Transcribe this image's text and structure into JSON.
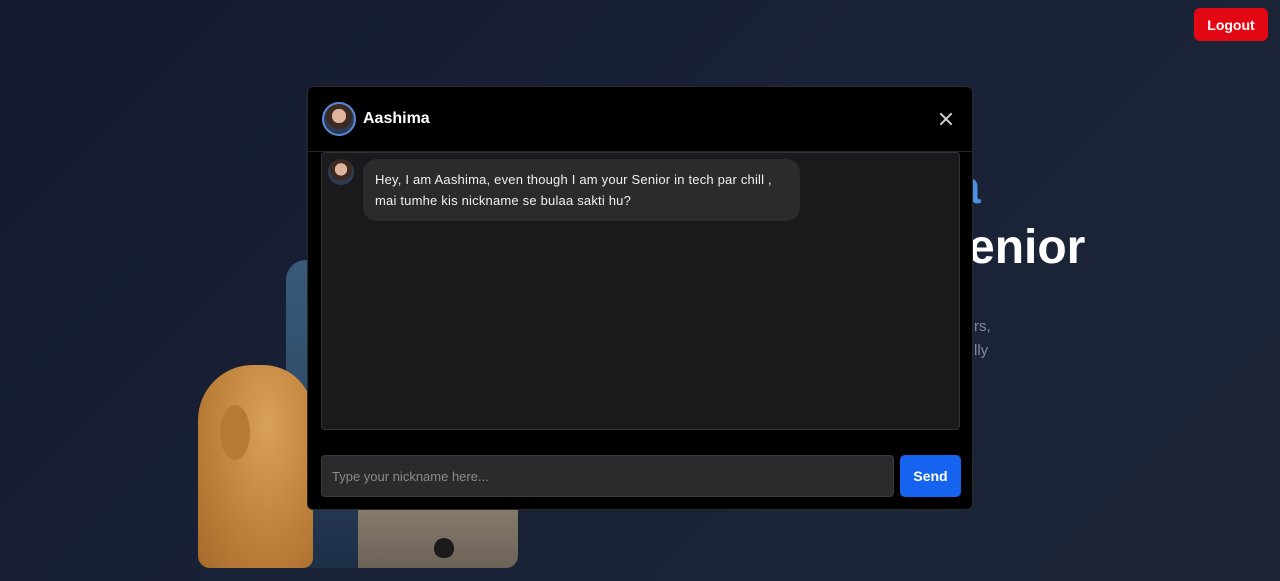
{
  "header": {
    "logout_label": "Logout"
  },
  "hero": {
    "accent_fragment": "a",
    "main_fragment": "enior",
    "desc_line_1": "rs,",
    "desc_line_2": "lly"
  },
  "chat": {
    "name": "Aashima",
    "messages": [
      {
        "text": "Hey, I am Aashima, even though I am your Senior in tech par chill , mai tumhe kis nickname se bulaa sakti hu?"
      }
    ],
    "input_placeholder": "Type your nickname here...",
    "input_value": "",
    "send_label": "Send"
  },
  "colors": {
    "logout": "#e30613",
    "send": "#1663f0",
    "accent_text": "#4d8fe6"
  },
  "icons": {
    "close": "close-icon",
    "avatar": "avatar"
  }
}
